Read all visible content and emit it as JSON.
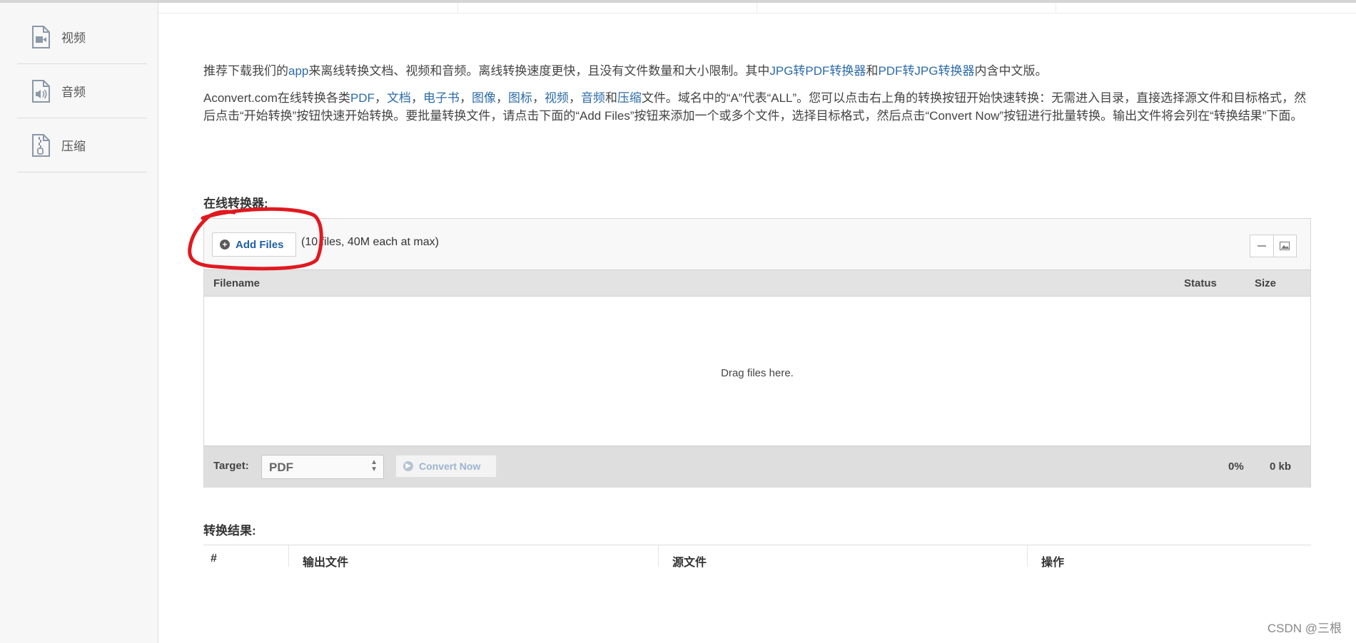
{
  "sidebar": {
    "items": [
      {
        "label": "视频",
        "icon": "video-file-icon"
      },
      {
        "label": "音频",
        "icon": "audio-file-icon"
      },
      {
        "label": "压缩",
        "icon": "archive-file-icon"
      }
    ]
  },
  "intro": {
    "line1": [
      {
        "text": "推荐下载我们的",
        "link": false
      },
      {
        "text": "app",
        "link": true
      },
      {
        "text": "来离线转换文档、视频和音频。离线转换速度更快，且没有文件数量和大小限制。其中",
        "link": false
      },
      {
        "text": "JPG转PDF转换器",
        "link": true
      },
      {
        "text": "和",
        "link": false
      },
      {
        "text": "PDF转JPG转换器",
        "link": true
      },
      {
        "text": "内含中文版。",
        "link": false
      }
    ],
    "line2": [
      {
        "text": "Aconvert.com在线转换各类",
        "link": false
      },
      {
        "text": "PDF",
        "link": true
      },
      {
        "text": "，",
        "link": false
      },
      {
        "text": "文档",
        "link": true
      },
      {
        "text": "，",
        "link": false
      },
      {
        "text": "电子书",
        "link": true
      },
      {
        "text": "，",
        "link": false
      },
      {
        "text": "图像",
        "link": true
      },
      {
        "text": "，",
        "link": false
      },
      {
        "text": "图标",
        "link": true
      },
      {
        "text": "，",
        "link": false
      },
      {
        "text": "视频",
        "link": true
      },
      {
        "text": "，",
        "link": false
      },
      {
        "text": "音频",
        "link": true
      },
      {
        "text": "和",
        "link": false
      },
      {
        "text": "压缩",
        "link": true
      },
      {
        "text": "文件。域名中的“A”代表“ALL”。您可以点击右上角的转换按钮开始快速转换：无需进入目录，直接选择源文件和目标格式，然后点击“开始转换”按钮快速开始转换。要批量转换文件，请点击下面的“Add Files”按钮来添加一个或多个文件，选择目标格式，然后点击“Convert Now”按钮进行批量转换。输出文件将会列在“转换结果”下面。",
        "link": false
      }
    ]
  },
  "converter": {
    "title": "在线转换器:",
    "add_files_label": "Add Files",
    "limit_note": "(10 files, 40M each at max)",
    "columns": {
      "filename": "Filename",
      "status": "Status",
      "size": "Size"
    },
    "dropzone_text": "Drag files here.",
    "target_label": "Target:",
    "target_value": "PDF",
    "convert_label": "Convert Now",
    "progress": "0%",
    "total_size": "0 kb"
  },
  "results": {
    "title": "转换结果:",
    "columns": [
      "#",
      "输出文件",
      "源文件",
      "操作"
    ]
  },
  "watermark": "CSDN @三根",
  "colors": {
    "link": "#2d6ba8",
    "add_button_text": "#1f5fa6",
    "annotation": "#e0191f"
  }
}
